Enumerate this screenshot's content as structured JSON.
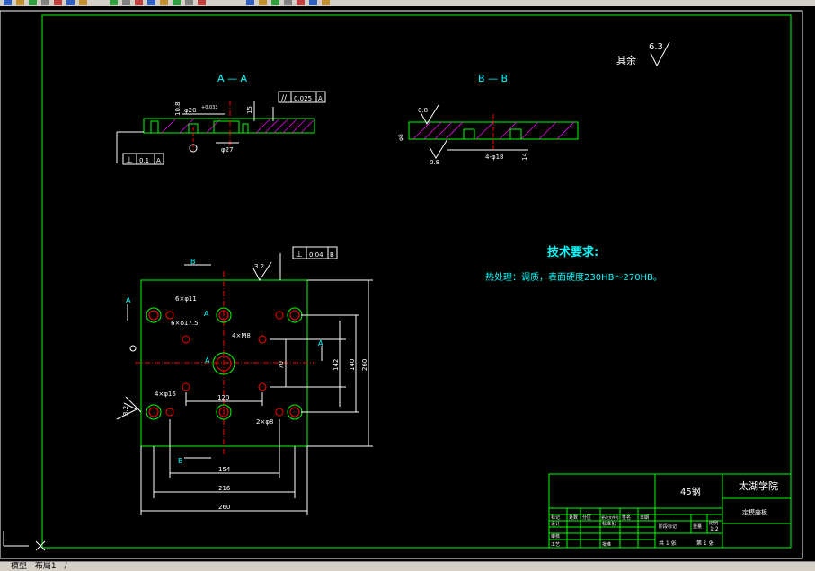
{
  "colors": {
    "frame": "#00ff00",
    "text_cyan": "#00ffff",
    "text_white": "#ffffff",
    "centerline": "#ff0000",
    "hatch": "#ff00ff",
    "background": "#000000",
    "toolbar": "#d4d0c8"
  },
  "toolbar": {
    "icons": [
      "new-icon",
      "open-icon",
      "save-icon",
      "print-icon",
      "preview-icon",
      "cut-icon",
      "copy-icon",
      "paste-icon",
      "match-icon",
      "undo-icon",
      "redo-icon",
      "pan-icon",
      "zoom-icon",
      "zoom-window-icon",
      "zoom-prev-icon",
      "properties-icon",
      "design-center-icon",
      "tool-palette-icon",
      "sheet-set-icon",
      "markup-icon",
      "calc-icon",
      "help-icon"
    ]
  },
  "drawing": {
    "section_aa": "A — A",
    "section_bb": "B — B",
    "roughness_rest_label": "其余",
    "roughness_rest_value": "6.3",
    "aa": {
      "dim_height": "10.8",
      "dim_dia_top": "φ20",
      "dim_tol": "+0.033",
      "dim_15": "15",
      "dim_dia27": "φ27",
      "parallel_tol": "0.025",
      "parallel_ref": "A",
      "perp_tol": "0.1",
      "perp_ref": "A"
    },
    "bb": {
      "rough_top": "0.8",
      "rough_bottom": "0.8",
      "dim_left": "φ8",
      "dim_holes": "4-φ18",
      "dim_14": "14"
    },
    "tech_req_title": "技术要求:",
    "tech_req_body": "热处理：调质，表面硬度230HB～270HB。",
    "plan": {
      "perp_tol": "0.04",
      "perp_ref": "B",
      "rough": "3.2",
      "rough_left": "3.2",
      "label_b_top": "B",
      "label_b_bottom": "B",
      "label_a_left": "A",
      "label_a_right": "A",
      "label_a_center": "A",
      "label_a_hole": "A",
      "holes_6x11": "6×φ11",
      "holes_6x17": "6×φ17.5",
      "hole_4xm8": "4×M8",
      "holes_4x16": "4×φ16",
      "holes_2x8": "2×φ8",
      "dim_70": "70",
      "dim_142": "142",
      "dim_140": "140",
      "dim_260v": "260",
      "dim_120": "120",
      "dim_154": "154",
      "dim_216": "216",
      "dim_260h": "260"
    },
    "title_block": {
      "material": "45钢",
      "school": "太湖学院",
      "part_name": "定模座板",
      "scale": "1:2",
      "sheet_total": "共 1 张",
      "sheet_no": "第 1 张",
      "row_labels": [
        "标记",
        "处数",
        "分区",
        "更改文件号",
        "签名",
        "日期"
      ],
      "design": "设计",
      "standard": "标准化",
      "review": "审核",
      "process": "工艺",
      "approve": "批准",
      "stage_labels": [
        "阶段标记",
        "重量",
        "比例"
      ]
    }
  },
  "status": {
    "tabs": [
      "模型",
      "布局1",
      "/"
    ]
  }
}
